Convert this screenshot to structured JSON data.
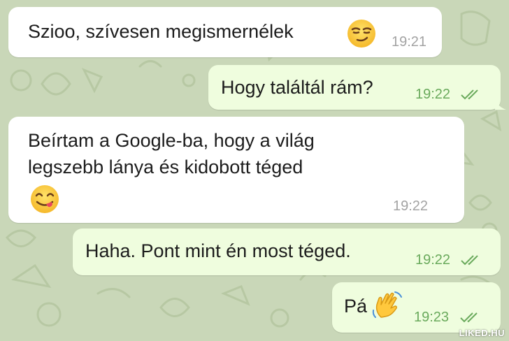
{
  "messages": [
    {
      "direction": "in",
      "text": "Szioo, szívesen megismernélek",
      "emoji": "smirking-face-icon",
      "time": "19:21"
    },
    {
      "direction": "out",
      "text": "Hogy találtál rám?",
      "time": "19:22",
      "status": "read"
    },
    {
      "direction": "in",
      "lines": [
        "Beírtam a Google-ba, hogy a világ",
        "legszebb lánya és kidobott téged"
      ],
      "emoji": "face-savoring-food-icon",
      "time": "19:22"
    },
    {
      "direction": "out",
      "text": "Haha. Pont mint én most téged.",
      "time": "19:22",
      "status": "read"
    },
    {
      "direction": "out",
      "text": "Pá",
      "emoji": "waving-hand-icon",
      "time": "19:23",
      "status": "read"
    }
  ],
  "watermark": "LIKED.HU",
  "colors": {
    "background": "#c9d7b8",
    "incoming_bubble": "#ffffff",
    "outgoing_bubble": "#effdde",
    "outgoing_time": "#6aaa5c",
    "incoming_time": "#a3a3a3"
  }
}
